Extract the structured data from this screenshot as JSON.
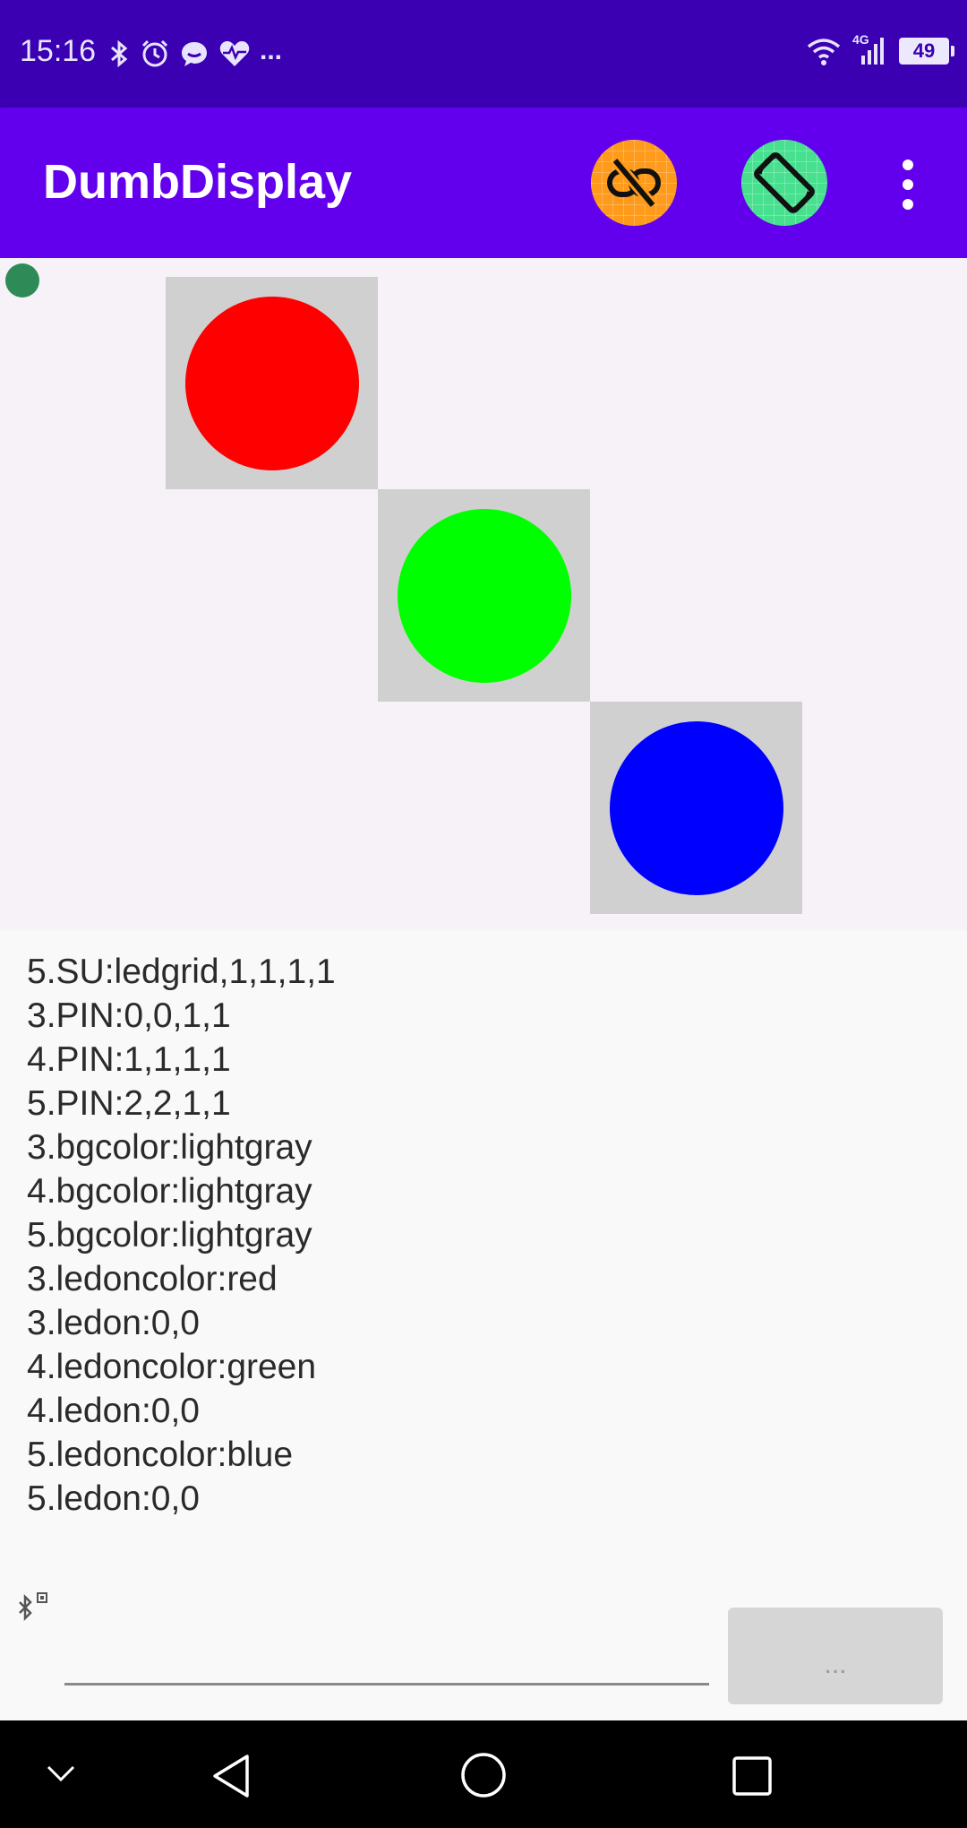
{
  "status_bar": {
    "time": "15:16",
    "left_icons": [
      "bluetooth-icon",
      "alarm-icon",
      "chat-bubble-icon",
      "heart-pulse-icon",
      "more-dots-icon"
    ],
    "more_text": "...",
    "network": "4G",
    "battery": "49"
  },
  "app_bar": {
    "title": "DumbDisplay",
    "actions": [
      "link-off-icon",
      "screen-rotation-icon",
      "overflow-menu-icon"
    ]
  },
  "display": {
    "background": "#f6f2f7",
    "connection_dot_color": "#2e8b57",
    "leds": [
      {
        "bgcolor": "lightgray",
        "oncolor": "red",
        "color_hex": "#ff0000",
        "state": "on"
      },
      {
        "bgcolor": "lightgray",
        "oncolor": "green",
        "color_hex": "#00ff00",
        "state": "on"
      },
      {
        "bgcolor": "lightgray",
        "oncolor": "blue",
        "color_hex": "#0000ff",
        "state": "on"
      }
    ]
  },
  "log_lines": [
    "5.SU:ledgrid,1,1,1,1",
    "3.PIN:0,0,1,1",
    "4.PIN:1,1,1,1",
    "5.PIN:2,2,1,1",
    "3.bgcolor:lightgray",
    "4.bgcolor:lightgray",
    "5.bgcolor:lightgray",
    "3.ledoncolor:red",
    "3.ledon:0,0",
    "4.ledoncolor:green",
    "4.ledon:0,0",
    "5.ledoncolor:blue",
    "5.ledon:0,0"
  ],
  "command_input": {
    "value": "",
    "placeholder": ""
  },
  "send_button": {
    "label": "..."
  },
  "nav_bar": {
    "buttons": [
      "collapse-chevron-icon",
      "back-icon",
      "home-icon",
      "recents-icon"
    ]
  }
}
